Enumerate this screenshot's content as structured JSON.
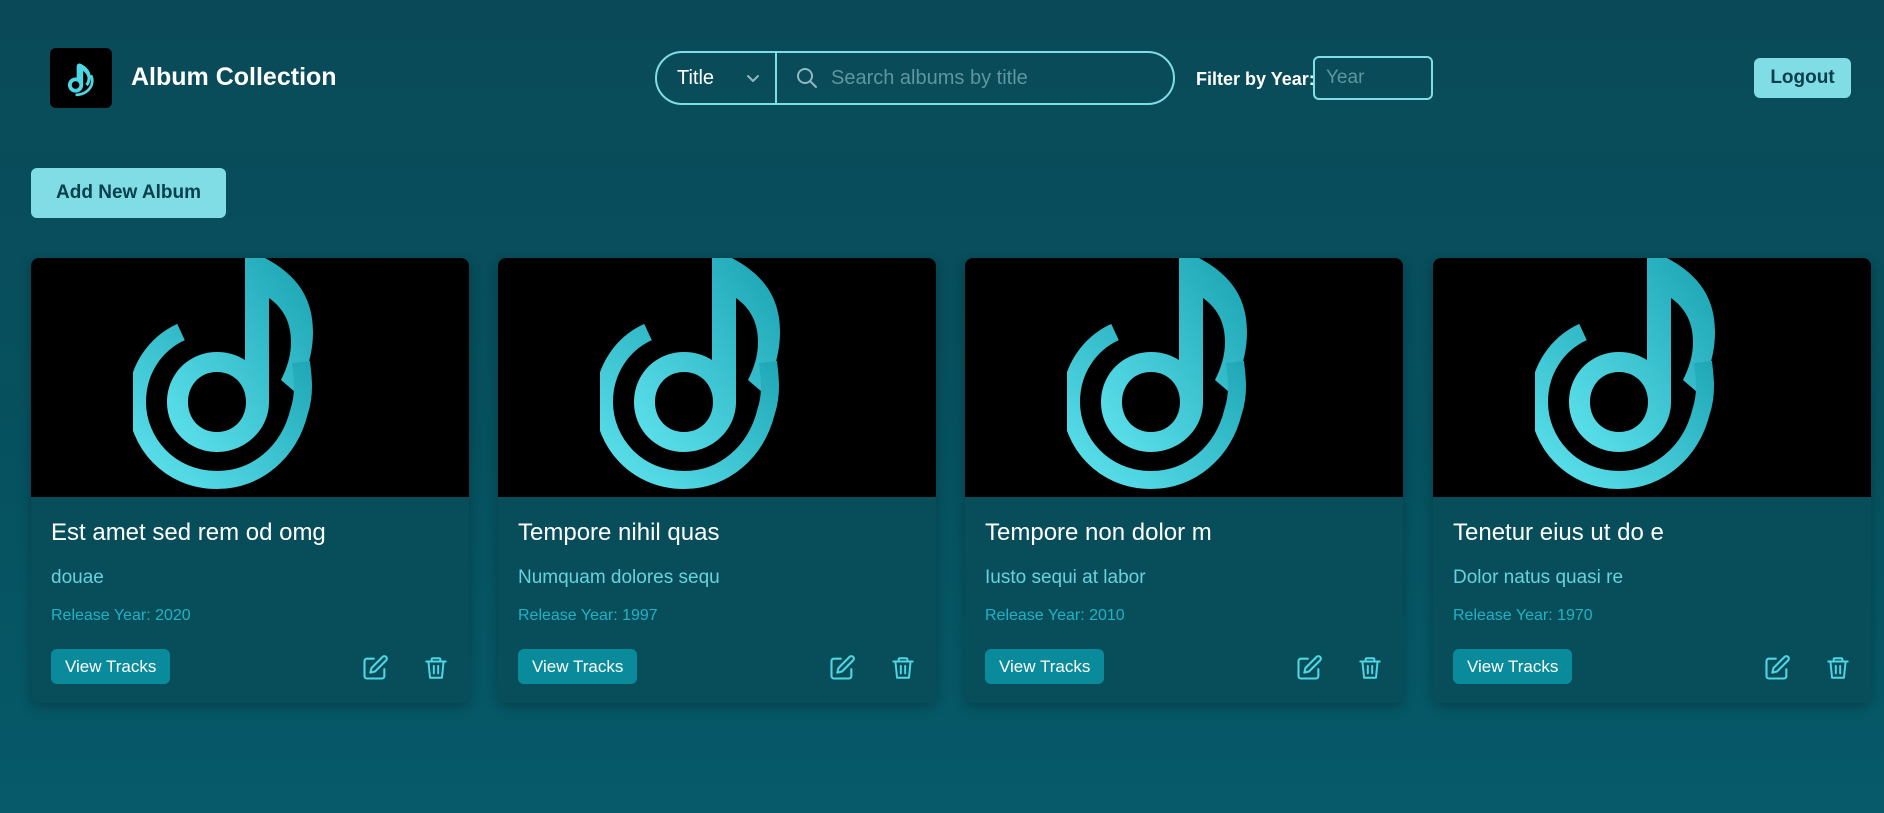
{
  "header": {
    "app_title": "Album Collection",
    "logo_icon": "music-note-icon",
    "search": {
      "field_select": "Title",
      "placeholder": "Search albums by title",
      "value": ""
    },
    "year_filter": {
      "label": "Filter by Year:",
      "placeholder": "Year",
      "value": ""
    },
    "logout_label": "Logout"
  },
  "actions": {
    "add_album_label": "Add New Album"
  },
  "colors": {
    "accent": "#80dde6",
    "teal_button": "#0a8b9c",
    "background": "#06515f",
    "card": "#084e5a",
    "icon": "#4fd6e3"
  },
  "albums": [
    {
      "title": "Est amet sed rem od omg",
      "artist": "douae",
      "year_label": "Release Year: 2020",
      "view_label": "View Tracks"
    },
    {
      "title": "Tempore nihil quas",
      "artist": "Numquam dolores sequ",
      "year_label": "Release Year: 1997",
      "view_label": "View Tracks"
    },
    {
      "title": "Tempore non dolor m",
      "artist": "Iusto sequi at labor",
      "year_label": "Release Year: 2010",
      "view_label": "View Tracks"
    },
    {
      "title": "Tenetur eius ut do e",
      "artist": "Dolor natus quasi re",
      "year_label": "Release Year: 1970",
      "view_label": "View Tracks"
    }
  ]
}
